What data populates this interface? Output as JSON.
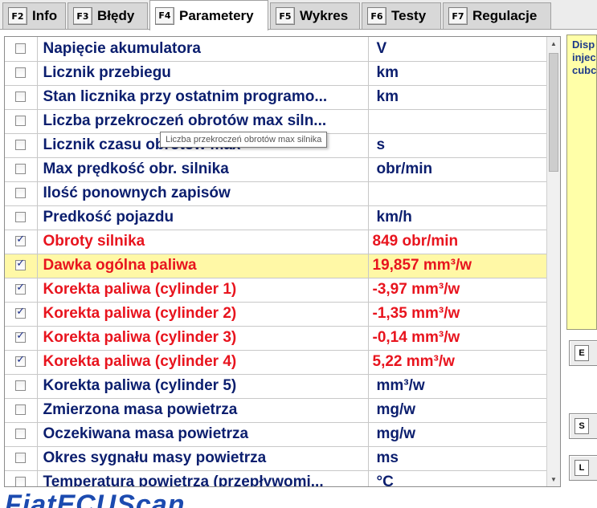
{
  "tabs": [
    {
      "key": "F2",
      "label": "Info",
      "active": false
    },
    {
      "key": "F3",
      "label": "Błędy",
      "active": false
    },
    {
      "key": "F4",
      "label": "Parametery",
      "active": true
    },
    {
      "key": "F5",
      "label": "Wykres",
      "active": false
    },
    {
      "key": "F6",
      "label": "Testy",
      "active": false
    },
    {
      "key": "F7",
      "label": "Regulacje",
      "active": false
    }
  ],
  "parameters": [
    {
      "name": "Napięcie akumulatora",
      "value": "V",
      "checked": false
    },
    {
      "name": "Licznik przebiegu",
      "value": "km",
      "checked": false
    },
    {
      "name": "Stan licznika przy ostatnim programo...",
      "value": "km",
      "checked": false
    },
    {
      "name": "Liczba przekroczeń obrotów max siln...",
      "value": "",
      "checked": false
    },
    {
      "name": "Licznik czasu obrotów max",
      "value": "s",
      "checked": false
    },
    {
      "name": "Max prędkość obr. silnika",
      "value": "obr/min",
      "checked": false
    },
    {
      "name": "Ilość ponownych zapisów",
      "value": "",
      "checked": false
    },
    {
      "name": "Predkość pojazdu",
      "value": "km/h",
      "checked": false
    },
    {
      "name": "Obroty silnika",
      "value": "849 obr/min",
      "checked": true
    },
    {
      "name": "Dawka ogólna paliwa",
      "value": "19,857 mm³/w",
      "checked": true,
      "selected": true
    },
    {
      "name": "Korekta paliwa (cylinder 1)",
      "value": "-3,97 mm³/w",
      "checked": true
    },
    {
      "name": "Korekta paliwa (cylinder 2)",
      "value": "-1,35 mm³/w",
      "checked": true
    },
    {
      "name": "Korekta paliwa (cylinder 3)",
      "value": "-0,14 mm³/w",
      "checked": true
    },
    {
      "name": "Korekta paliwa (cylinder 4)",
      "value": "5,22 mm³/w",
      "checked": true
    },
    {
      "name": "Korekta paliwa (cylinder 5)",
      "value": "mm³/w",
      "checked": false
    },
    {
      "name": "Zmierzona masa powietrza",
      "value": "mg/w",
      "checked": false
    },
    {
      "name": "Oczekiwana masa powietrza",
      "value": "mg/w",
      "checked": false
    },
    {
      "name": "Okres sygnału masy powietrza",
      "value": "ms",
      "checked": false
    },
    {
      "name": "Temperatura powietrza (przepływomi...",
      "value": "°C",
      "checked": false
    }
  ],
  "tooltip": {
    "text": "Liczba przekroczeń obrotów max silnika"
  },
  "info_panel": {
    "lines": [
      "Disp",
      "injec",
      "cubc"
    ]
  },
  "side_buttons": [
    {
      "key": "E"
    },
    {
      "key": "S"
    },
    {
      "key": "L"
    }
  ],
  "logo": {
    "text": "FiatECUScan"
  },
  "colors": {
    "active_param": "#e8141e",
    "inactive_param": "#0b1e6e",
    "selected_row_bg": "#fff8a6",
    "info_panel_bg": "#ffffa8"
  }
}
